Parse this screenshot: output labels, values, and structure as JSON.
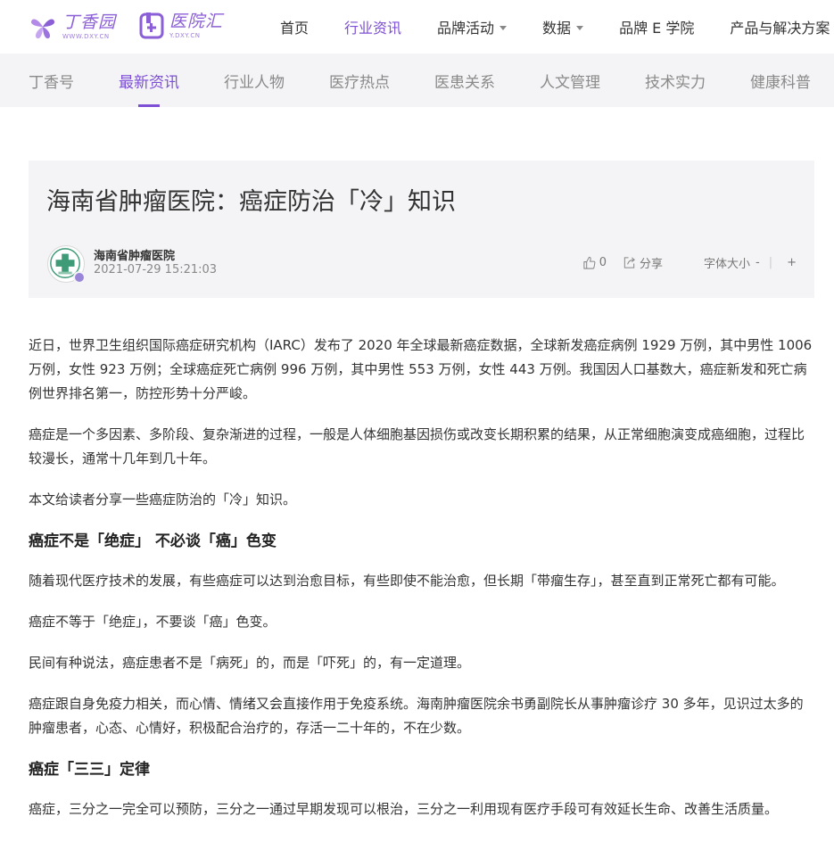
{
  "header": {
    "logo_primary": {
      "text": "丁香园",
      "url_text": "WWW.DXY.CN"
    },
    "logo_secondary": {
      "text": "医院汇",
      "url_text": "Y.DXY.CN"
    },
    "nav": [
      {
        "label": "首页",
        "dropdown": false,
        "active": false
      },
      {
        "label": "行业资讯",
        "dropdown": false,
        "active": true
      },
      {
        "label": "品牌活动",
        "dropdown": true,
        "active": false
      },
      {
        "label": "数据",
        "dropdown": true,
        "active": false
      },
      {
        "label": "品牌 E 学院",
        "dropdown": false,
        "active": false
      },
      {
        "label": "产品与解决方案",
        "dropdown": false,
        "active": false
      }
    ]
  },
  "subnav": [
    {
      "label": "丁香号",
      "active": false
    },
    {
      "label": "最新资讯",
      "active": true
    },
    {
      "label": "行业人物",
      "active": false
    },
    {
      "label": "医疗热点",
      "active": false
    },
    {
      "label": "医患关系",
      "active": false
    },
    {
      "label": "人文管理",
      "active": false
    },
    {
      "label": "技术实力",
      "active": false
    },
    {
      "label": "健康科普",
      "active": false
    }
  ],
  "article": {
    "title": "海南省肿瘤医院：癌症防治「冷」知识",
    "author": "海南省肿瘤医院",
    "date": "2021-07-29 15:21:03",
    "like_count": "0",
    "share_label": "分享",
    "font_size_label": "字体大小",
    "font_decrease": "-",
    "font_increase": "+",
    "blocks": [
      {
        "type": "p",
        "text": "近日，世界卫生组织国际癌症研究机构（IARC）发布了 2020 年全球最新癌症数据，全球新发癌症病例 1929 万例，其中男性 1006 万例，女性 923 万例；全球癌症死亡病例 996 万例，其中男性 553 万例，女性 443 万例。我国因人口基数大，癌症新发和死亡病例世界排名第一，防控形势十分严峻。"
      },
      {
        "type": "p",
        "text": "癌症是一个多因素、多阶段、复杂渐进的过程，一般是人体细胞基因损伤或改变长期积累的结果，从正常细胞演变成癌细胞，过程比较漫长，通常十几年到几十年。"
      },
      {
        "type": "p",
        "text": "本文给读者分享一些癌症防治的「冷」知识。"
      },
      {
        "type": "h",
        "text": "癌症不是「绝症」 不必谈「癌」色变"
      },
      {
        "type": "p",
        "text": "随着现代医疗技术的发展，有些癌症可以达到治愈目标，有些即使不能治愈，但长期「带瘤生存」，甚至直到正常死亡都有可能。"
      },
      {
        "type": "p",
        "text": "癌症不等于「绝症」，不要谈「癌」色变。"
      },
      {
        "type": "p",
        "text": "民间有种说法，癌症患者不是「病死」的，而是「吓死」的，有一定道理。"
      },
      {
        "type": "p",
        "text": "癌症跟自身免疫力相关，而心情、情绪又会直接作用于免疫系统。海南肿瘤医院余书勇副院长从事肿瘤诊疗 30 多年，见识过太多的肿瘤患者，心态、心情好，积极配合治疗的，存活一二十年的，不在少数。"
      },
      {
        "type": "h",
        "text": "癌症「三三」定律"
      },
      {
        "type": "p",
        "text": "癌症，三分之一完全可以预防，三分之一通过早期发现可以根治，三分之一利用现有医疗手段可有效延长生命、改善生活质量。"
      }
    ]
  },
  "colors": {
    "brand": "#7c4fd4",
    "card_bg": "#f4f4f6",
    "text": "#333333",
    "muted": "#888888"
  },
  "icons": {
    "logo_primary": "clove-flower-logo-icon",
    "logo_secondary": "hospital-cross-logo-icon",
    "like": "thumbs-up-icon",
    "share": "share-icon",
    "verified": "verified-badge-icon"
  }
}
